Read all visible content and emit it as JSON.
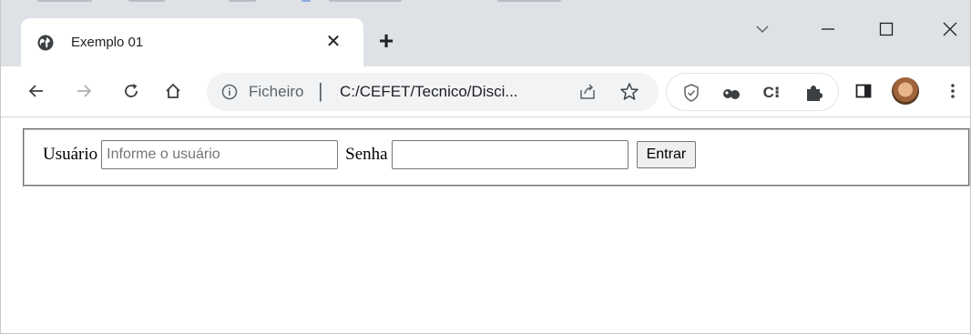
{
  "browser": {
    "tab": {
      "title": "Exemplo 01",
      "close_glyph": "✕",
      "favicon": "globe-icon"
    },
    "new_tab_glyph": "+",
    "window_controls": {
      "tab_search": "chevron-down-icon",
      "minimize": "—",
      "maximize": "☐",
      "close": "✕"
    },
    "toolbar": {
      "back": "←",
      "forward": "→",
      "reload": "C",
      "home": "⌂",
      "more": "⋮"
    },
    "omnibox": {
      "scheme_label": "Ficheiro",
      "separator": "|",
      "url": "C:/CEFET/Tecnico/Disci..."
    },
    "extensions": {
      "icons": [
        "shield-icon",
        "binoculars-icon",
        "css-icon",
        "puzzle-icon"
      ],
      "css_icon_text": "C⁝",
      "side_panel": "side-panel-icon",
      "avatar": "profile-avatar"
    }
  },
  "page": {
    "login_form": {
      "user_label": "Usuário",
      "user_placeholder": "Informe o usuário",
      "user_value": "",
      "password_label": "Senha",
      "password_value": "",
      "submit_label": "Entrar"
    }
  },
  "colors": {
    "tabstrip_bg": "#dee1e6",
    "omnibox_bg": "#f1f3f4",
    "icon_gray": "#5f6368"
  }
}
